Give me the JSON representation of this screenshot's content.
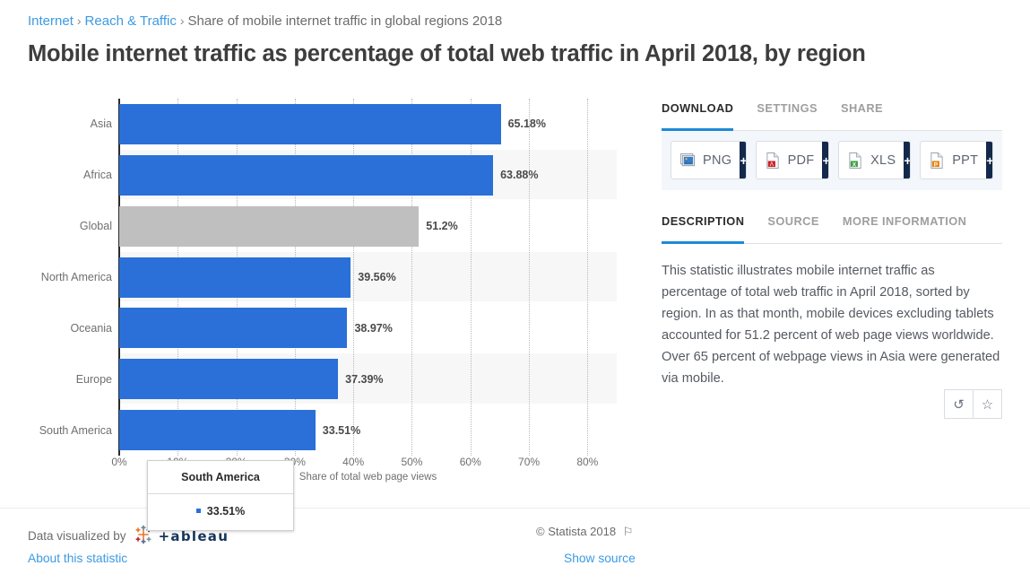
{
  "breadcrumb": {
    "items": [
      {
        "label": "Internet",
        "link": true
      },
      {
        "label": "Reach & Traffic",
        "link": true
      },
      {
        "label": "Share of mobile internet traffic in global regions 2018",
        "link": false
      }
    ],
    "separator": "›"
  },
  "page_title": "Mobile internet traffic as percentage of total web traffic in April 2018, by region",
  "chart_data": {
    "type": "bar",
    "orientation": "horizontal",
    "title": "Mobile internet traffic as percentage of total web traffic in April 2018, by region",
    "xlabel": "Share of total web page views",
    "ylabel": "",
    "xlim": [
      0,
      85
    ],
    "xticks": [
      "0%",
      "10%",
      "20%",
      "30%",
      "40%",
      "50%",
      "60%",
      "70%",
      "80%"
    ],
    "xtick_values": [
      0,
      10,
      20,
      30,
      40,
      50,
      60,
      70,
      80
    ],
    "grid": true,
    "legend": "none",
    "categories": [
      "Asia",
      "Africa",
      "Global",
      "North America",
      "Oceania",
      "Europe",
      "South America"
    ],
    "values": [
      65.18,
      63.88,
      51.2,
      39.56,
      38.97,
      37.39,
      33.51
    ],
    "value_labels": [
      "65.18%",
      "63.88%",
      "51.2%",
      "39.56%",
      "38.97%",
      "37.39%",
      "33.51%"
    ],
    "series_color": "#2a70d8",
    "highlight_color": "#bfbfbf",
    "highlight_category": "Global"
  },
  "tooltip": {
    "title": "South America",
    "value": "33.51%"
  },
  "panel": {
    "action_tabs": [
      {
        "label": "DOWNLOAD",
        "active": true
      },
      {
        "label": "SETTINGS",
        "active": false
      },
      {
        "label": "SHARE",
        "active": false
      }
    ],
    "download_buttons": [
      {
        "label": "PNG",
        "icon": "image-file-icon",
        "plus": "+"
      },
      {
        "label": "PDF",
        "icon": "pdf-file-icon",
        "plus": "+"
      },
      {
        "label": "XLS",
        "icon": "excel-file-icon",
        "plus": "+"
      },
      {
        "label": "PPT",
        "icon": "powerpoint-file-icon",
        "plus": "+"
      }
    ],
    "info_tabs": [
      {
        "label": "DESCRIPTION",
        "active": true
      },
      {
        "label": "SOURCE",
        "active": false
      },
      {
        "label": "MORE INFORMATION",
        "active": false
      }
    ],
    "description": "This statistic illustrates mobile internet traffic as percentage of total web traffic in April 2018, sorted by region. In as that month, mobile devices excluding tablets accounted for 51.2 percent of web page views worldwide. Over 65 percent of webpage views in Asia were generated via mobile.",
    "actions": [
      {
        "icon": "reset-icon",
        "glyph": "↺"
      },
      {
        "icon": "favorite-star-icon",
        "glyph": "☆"
      }
    ]
  },
  "footer": {
    "visualized_by": "Data visualized by",
    "tableau_wordmark": "+ableau",
    "about_link": "About this statistic",
    "copyright": "© Statista 2018",
    "flag_icon": "⚐",
    "show_source": "Show source"
  },
  "colors": {
    "accent_blue": "#2a70d8",
    "link_blue": "#3d9ae2",
    "tab_underline": "#1d8ad6",
    "grey_bar": "#bfbfbf",
    "navy": "#13294b"
  }
}
